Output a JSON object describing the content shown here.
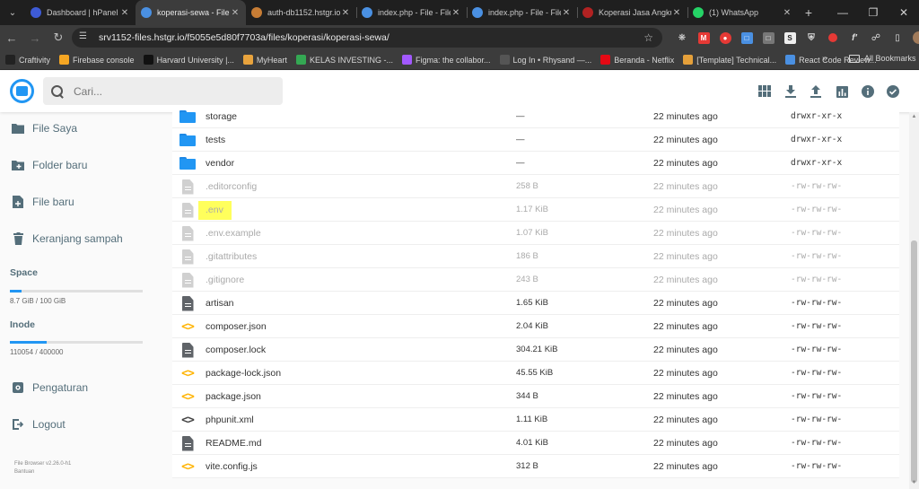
{
  "browser": {
    "tabs": [
      {
        "label": "Dashboard | hPanel",
        "color": "#3e5bd6"
      },
      {
        "label": "koperasi-sewa - File",
        "color": "#4a90e2",
        "active": true
      },
      {
        "label": "auth-db1152.hstgr.io",
        "color": "#c77d35"
      },
      {
        "label": "index.php - File - File",
        "color": "#4a90e2"
      },
      {
        "label": "index.php - File - File",
        "color": "#4a90e2"
      },
      {
        "label": "Koperasi Jasa Angku",
        "color": "#b22222"
      },
      {
        "label": "(1) WhatsApp",
        "color": "#25d366"
      }
    ],
    "url": "srv1152-files.hstgr.io/f5055e5d80f7703a/files/koperasi/koperasi-sewa/",
    "bookmarks": [
      {
        "label": "Craftivity",
        "color": "#222"
      },
      {
        "label": "Firebase console",
        "color": "#f5a623"
      },
      {
        "label": "Harvard University |...",
        "color": "#111"
      },
      {
        "label": "MyHeart",
        "color": "#e8a33d"
      },
      {
        "label": "KELAS INVESTING -...",
        "color": "#34a853"
      },
      {
        "label": "Figma: the collabor...",
        "color": "#a259ff"
      },
      {
        "label": "Log In • Rhysand —...",
        "color": "#555"
      },
      {
        "label": "Beranda - Netflix",
        "color": "#e50914"
      },
      {
        "label": "[Template] Technical...",
        "color": "#e5a03a"
      },
      {
        "label": "React Code Review...",
        "color": "#4a90e2"
      }
    ],
    "all_bookmarks": "All Bookmarks"
  },
  "app": {
    "search_placeholder": "Cari...",
    "accent": "#2196f3"
  },
  "sidebar": {
    "items": [
      {
        "label": "File Saya",
        "icon": "folder-icon"
      },
      {
        "label": "Folder baru",
        "icon": "create-new-folder-icon"
      },
      {
        "label": "File baru",
        "icon": "note-add-icon"
      },
      {
        "label": "Keranjang sampah",
        "icon": "trash-icon"
      }
    ],
    "space": {
      "title": "Space",
      "value": "8.7 GiB / 100 GiB",
      "fraction": 0.087
    },
    "inode": {
      "title": "Inode",
      "value": "110054 / 400000",
      "fraction": 0.275
    },
    "settings": "Pengaturan",
    "logout": "Logout",
    "version": "File Browser v2.26.0-h1",
    "help": "Bantuan"
  },
  "files": [
    {
      "name": "storage",
      "size": "—",
      "modified": "22 minutes ago",
      "perm": "drwxr-xr-x",
      "type": "folder"
    },
    {
      "name": "tests",
      "size": "—",
      "modified": "22 minutes ago",
      "perm": "drwxr-xr-x",
      "type": "folder"
    },
    {
      "name": "vendor",
      "size": "—",
      "modified": "22 minutes ago",
      "perm": "drwxr-xr-x",
      "type": "folder"
    },
    {
      "name": ".editorconfig",
      "size": "258 B",
      "modified": "22 minutes ago",
      "perm": "-rw-rw-rw-",
      "type": "hidden"
    },
    {
      "name": ".env",
      "size": "1.17 KiB",
      "modified": "22 minutes ago",
      "perm": "-rw-rw-rw-",
      "type": "hidden",
      "highlight": true
    },
    {
      "name": ".env.example",
      "size": "1.07 KiB",
      "modified": "22 minutes ago",
      "perm": "-rw-rw-rw-",
      "type": "hidden"
    },
    {
      "name": ".gitattributes",
      "size": "186 B",
      "modified": "22 minutes ago",
      "perm": "-rw-rw-rw-",
      "type": "hidden"
    },
    {
      "name": ".gitignore",
      "size": "243 B",
      "modified": "22 minutes ago",
      "perm": "-rw-rw-rw-",
      "type": "hidden"
    },
    {
      "name": "artisan",
      "size": "1.65 KiB",
      "modified": "22 minutes ago",
      "perm": "-rw-rw-rw-",
      "type": "doc"
    },
    {
      "name": "composer.json",
      "size": "2.04 KiB",
      "modified": "22 minutes ago",
      "perm": "-rw-rw-rw-",
      "type": "code"
    },
    {
      "name": "composer.lock",
      "size": "304.21 KiB",
      "modified": "22 minutes ago",
      "perm": "-rw-rw-rw-",
      "type": "doc"
    },
    {
      "name": "package-lock.json",
      "size": "45.55 KiB",
      "modified": "22 minutes ago",
      "perm": "-rw-rw-rw-",
      "type": "code"
    },
    {
      "name": "package.json",
      "size": "344 B",
      "modified": "22 minutes ago",
      "perm": "-rw-rw-rw-",
      "type": "code"
    },
    {
      "name": "phpunit.xml",
      "size": "1.11 KiB",
      "modified": "22 minutes ago",
      "perm": "-rw-rw-rw-",
      "type": "code-dark"
    },
    {
      "name": "README.md",
      "size": "4.01 KiB",
      "modified": "22 minutes ago",
      "perm": "-rw-rw-rw-",
      "type": "doc"
    },
    {
      "name": "vite.config.js",
      "size": "312 B",
      "modified": "22 minutes ago",
      "perm": "-rw-rw-rw-",
      "type": "code"
    }
  ]
}
